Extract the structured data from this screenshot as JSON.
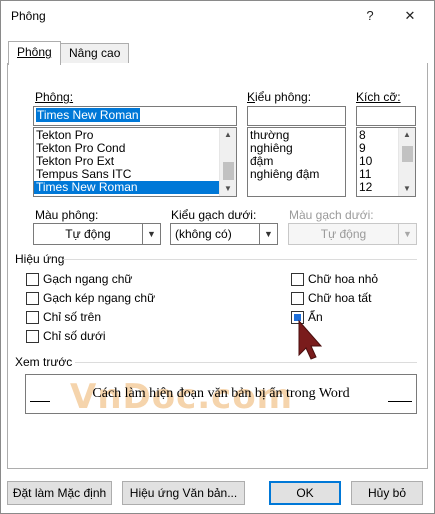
{
  "window": {
    "title": "Phông",
    "help_label": "?",
    "close_label": "✕"
  },
  "tabs": [
    {
      "label": "Phông"
    },
    {
      "label": "Nâng cao"
    }
  ],
  "font": {
    "label": "Phông:",
    "value": "Times New Roman",
    "list": [
      "Tekton Pro",
      "Tekton Pro Cond",
      "Tekton Pro Ext",
      "Tempus Sans ITC",
      "Times New Roman"
    ],
    "selected_index": 4
  },
  "style": {
    "label": "Kiểu phông:",
    "value": "",
    "list": [
      "thường",
      "nghiêng",
      "đậm",
      "nghiêng đậm"
    ]
  },
  "size": {
    "label": "Kích cỡ:",
    "value": "",
    "list": [
      "8",
      "9",
      "10",
      "11",
      "12"
    ]
  },
  "font_color": {
    "label": "Màu phông:",
    "value": "Tự động"
  },
  "underline_style": {
    "label": "Kiểu gạch dưới:",
    "value": "(không có)"
  },
  "underline_color": {
    "label": "Màu gạch dưới:",
    "value": "Tự động"
  },
  "effects": {
    "label": "Hiệu ứng",
    "left": [
      {
        "label": "Gạch ngang chữ",
        "checked": false
      },
      {
        "label": "Gạch kép ngang chữ",
        "checked": false
      },
      {
        "label": "Chỉ số trên",
        "checked": false
      },
      {
        "label": "Chỉ số dưới",
        "checked": false
      }
    ],
    "right": [
      {
        "label": "Chữ hoa nhỏ",
        "checked": false
      },
      {
        "label": "Chữ hoa tất",
        "checked": false
      },
      {
        "label": "Ẩn",
        "checked": true
      }
    ]
  },
  "preview": {
    "label": "Xem trước",
    "text": "Cách làm hiện đoạn văn bản bị ẩn trong Word",
    "watermark": "VnDoc.com"
  },
  "buttons": {
    "set_default": "Đặt làm Mặc định",
    "text_effects": "Hiệu ứng Văn bản...",
    "ok": "OK",
    "cancel": "Hủy bỏ"
  },
  "colors": {
    "accent": "#0078d7",
    "cursor": "#7a1c1c",
    "watermark": "#f2c28a"
  }
}
